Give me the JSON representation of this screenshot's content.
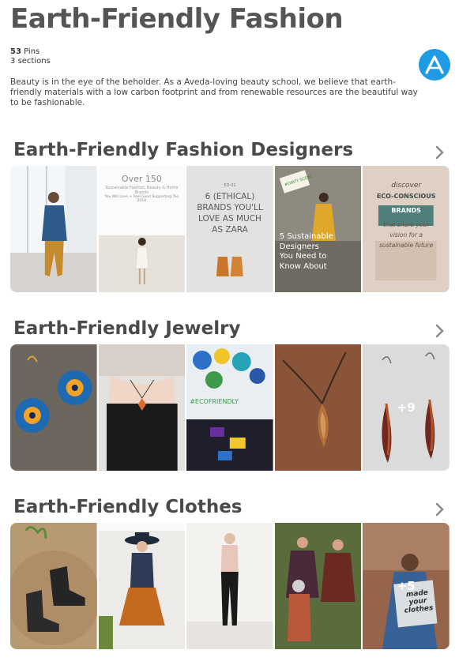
{
  "board": {
    "title": "Earth-Friendly Fashion",
    "pins_count": "53",
    "pins_label": "Pins",
    "sections_count": "3",
    "sections_label": "sections",
    "description": "Beauty is in the eye of the beholder. As a Aveda-loving beauty school, we believe that earth-friendly materials with a low carbon footprint and from renewable resources are the beautiful way to be fashionable.",
    "avatar_icon": "aveda-logo-icon",
    "avatar_color": "#1e9be3"
  },
  "sections": [
    {
      "title": "Earth-Friendly Fashion Designers",
      "tiles": [
        {
          "image": "woman-in-blue-jacket-by-window"
        },
        {
          "image": "over-150-sustainable-brands-pin",
          "heading": "Over 150",
          "subtitle": "Sustainable Fashion, Beauty & Home Brands",
          "caption": "You Will Love + Feel Good Supporting Too 2018"
        },
        {
          "image": "ethical-brands-pin",
          "pre": "ED-01",
          "text": "6 (ETHICAL) BRANDS YOU'LL LOVE AS MUCH AS ZARA"
        },
        {
          "image": "sustainable-designers-pin",
          "sign": "#DIRTY SCENE",
          "text": "5 Sustainable Designers You Need to Know About"
        },
        {
          "image": "eco-conscious-brands-pin",
          "text_a": "discover",
          "text_b": "ECO-CONSCIOUS",
          "text_c": "BRANDS",
          "text_d": "that share your vision for a sustainable future"
        }
      ]
    },
    {
      "title": "Earth-Friendly Jewelry",
      "tiles": [
        {
          "image": "blue-flower-quilled-earrings"
        },
        {
          "image": "woman-wearing-pendant-necklace"
        },
        {
          "image": "colorful-wooden-bead-necklace",
          "tag": "#ECOFRIENDLY"
        },
        {
          "image": "amber-bead-pendant-necklace"
        },
        {
          "image": "red-teardrop-earrings",
          "more": "+9"
        }
      ]
    },
    {
      "title": "Earth-Friendly Clothes",
      "tiles": [
        {
          "image": "black-ankle-boots-on-rug"
        },
        {
          "image": "woman-in-hat-and-orange-skirt"
        },
        {
          "image": "woman-in-black-trousers"
        },
        {
          "image": "women-in-patterned-ponchos"
        },
        {
          "image": "woman-holding-made-your-clothes-sign",
          "sign": "made your clothes",
          "more": "+5"
        }
      ]
    }
  ]
}
